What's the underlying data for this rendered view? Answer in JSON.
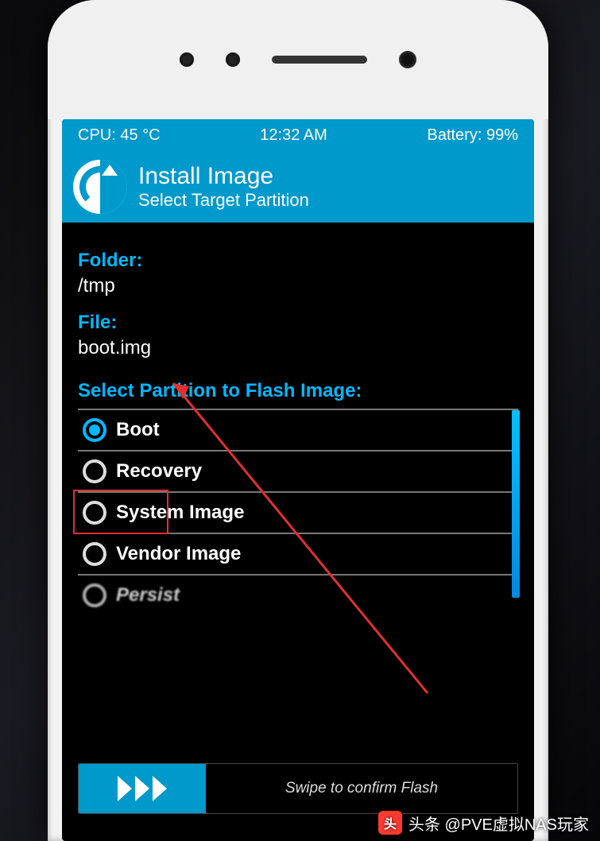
{
  "status": {
    "cpu": "CPU: 45 °C",
    "time": "12:32 AM",
    "battery": "Battery: 99%"
  },
  "header": {
    "title": "Install Image",
    "subtitle": "Select Target Partition"
  },
  "info": {
    "folder_label": "Folder:",
    "folder_value": "/tmp",
    "file_label": "File:",
    "file_value": "boot.img"
  },
  "section_title": "Select Partition to Flash Image:",
  "partitions": [
    {
      "label": "Boot",
      "selected": true
    },
    {
      "label": "Recovery",
      "selected": false
    },
    {
      "label": "System Image",
      "selected": false
    },
    {
      "label": "Vendor Image",
      "selected": false
    },
    {
      "label": "Persist",
      "selected": false
    }
  ],
  "swipe_label": "Swipe to confirm Flash",
  "watermark": "头条 @PVE虚拟NAS玩家"
}
